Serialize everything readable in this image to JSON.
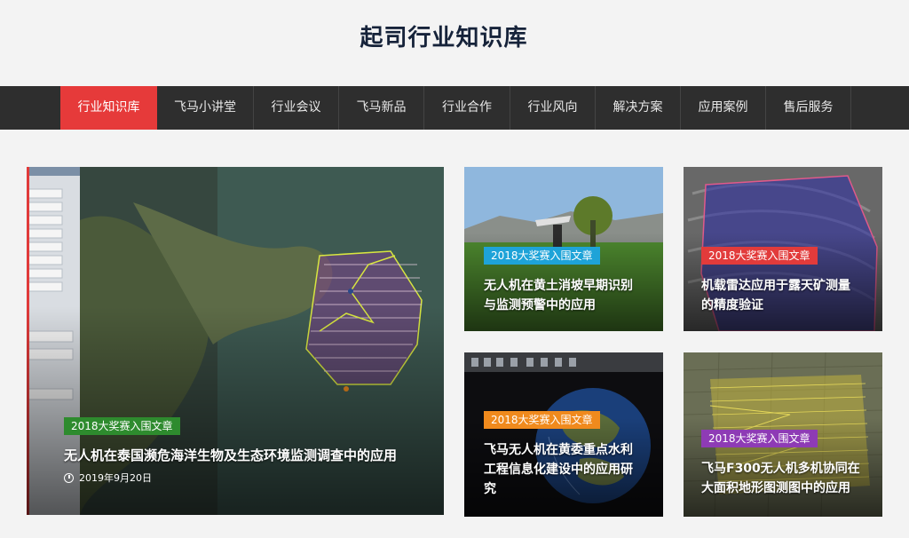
{
  "site": {
    "title": "起司行业知识库"
  },
  "nav": {
    "items": [
      {
        "label": "行业知识库",
        "active": true
      },
      {
        "label": "飞马小讲堂",
        "active": false
      },
      {
        "label": "行业会议",
        "active": false
      },
      {
        "label": "飞马新品",
        "active": false
      },
      {
        "label": "行业合作",
        "active": false
      },
      {
        "label": "行业风向",
        "active": false
      },
      {
        "label": "解决方案",
        "active": false
      },
      {
        "label": "应用案例",
        "active": false
      },
      {
        "label": "售后服务",
        "active": false
      }
    ]
  },
  "featured": {
    "badge": "2018大奖赛入围文章",
    "badge_color": "#2e8b2e",
    "title": "无人机在泰国濒危海洋生物及生态环境监测调查中的应用",
    "date": "2019年9月20日"
  },
  "cards": [
    {
      "badge": "2018大奖赛入围文章",
      "badge_color": "#1ea3d8",
      "title_line1": "无人机在黄土消坡早期识别",
      "title_line2": "与监测预警中的应用"
    },
    {
      "badge": "2018大奖赛入围文章",
      "badge_color": "#e23b3b",
      "title_line1": "机载雷达应用于露天矿测量",
      "title_line2": "的精度验证"
    },
    {
      "badge": "2018大奖赛入围文章",
      "badge_color": "#f08a1d",
      "title_line1": "飞马无人机在黄委重点水利",
      "title_line2": "工程信息化建设中的应用研",
      "title_line3": "究"
    },
    {
      "badge": "2018大奖赛入围文章",
      "badge_color": "#8e3bb5",
      "title_line1": "飞马F300无人机多机协同在",
      "title_line2": "大面积地形图测图中的应用"
    }
  ]
}
